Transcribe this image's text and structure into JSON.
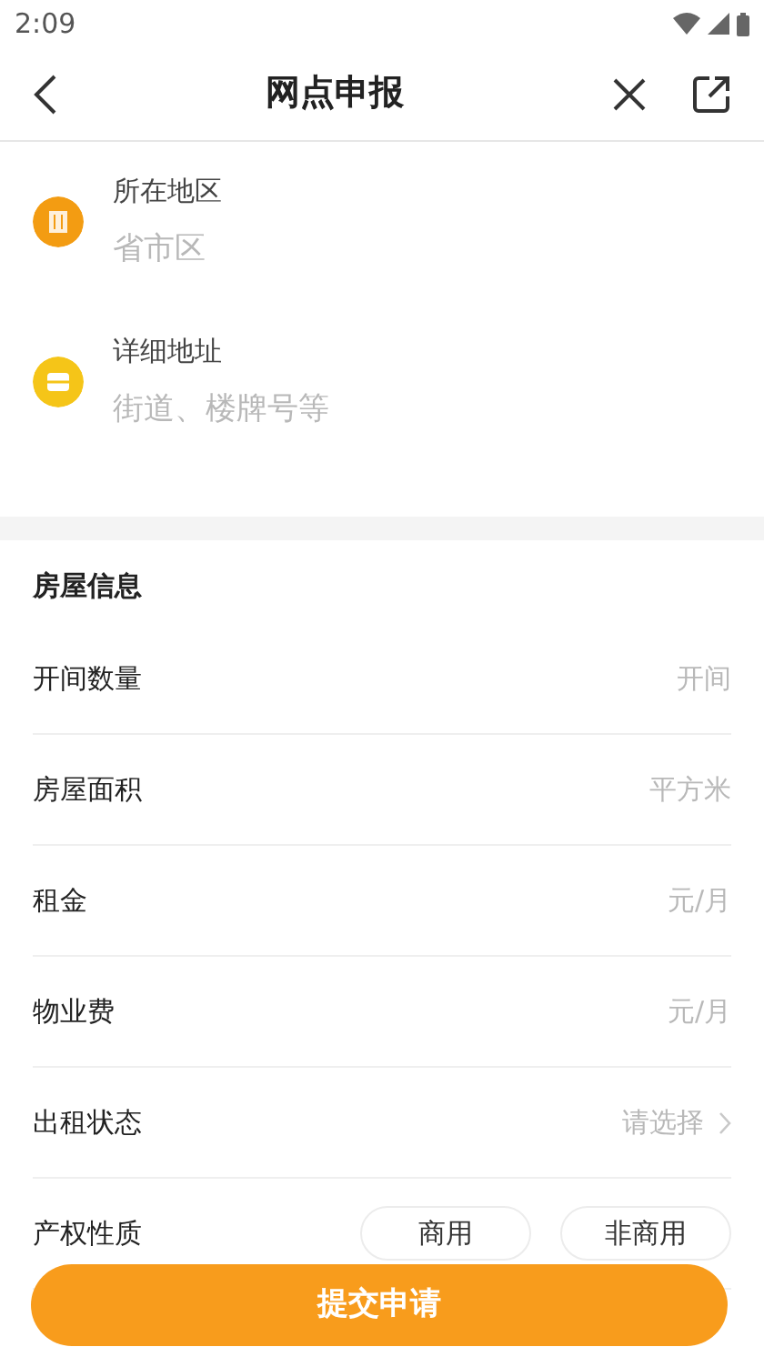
{
  "status_bar": {
    "time": "2:09"
  },
  "header": {
    "title": "网点申报"
  },
  "address": [
    {
      "label": "所在地区",
      "placeholder": "省市区"
    },
    {
      "label": "详细地址",
      "placeholder": "街道、楼牌号等"
    }
  ],
  "house_info": {
    "title": "房屋信息",
    "rows": [
      {
        "kind": "input",
        "label": "开间数量",
        "placeholder": "开间"
      },
      {
        "kind": "input",
        "label": "房屋面积",
        "placeholder": "平方米"
      },
      {
        "kind": "input",
        "label": "租金",
        "placeholder": "元/月"
      },
      {
        "kind": "input",
        "label": "物业费",
        "placeholder": "元/月"
      },
      {
        "kind": "select",
        "label": "出租状态",
        "placeholder": "请选择"
      },
      {
        "kind": "choice",
        "label": "产权性质",
        "options": [
          {
            "label": "商用",
            "selected": false
          },
          {
            "label": "非商用",
            "selected": false
          }
        ]
      }
    ]
  },
  "submit_button": "提交申请"
}
